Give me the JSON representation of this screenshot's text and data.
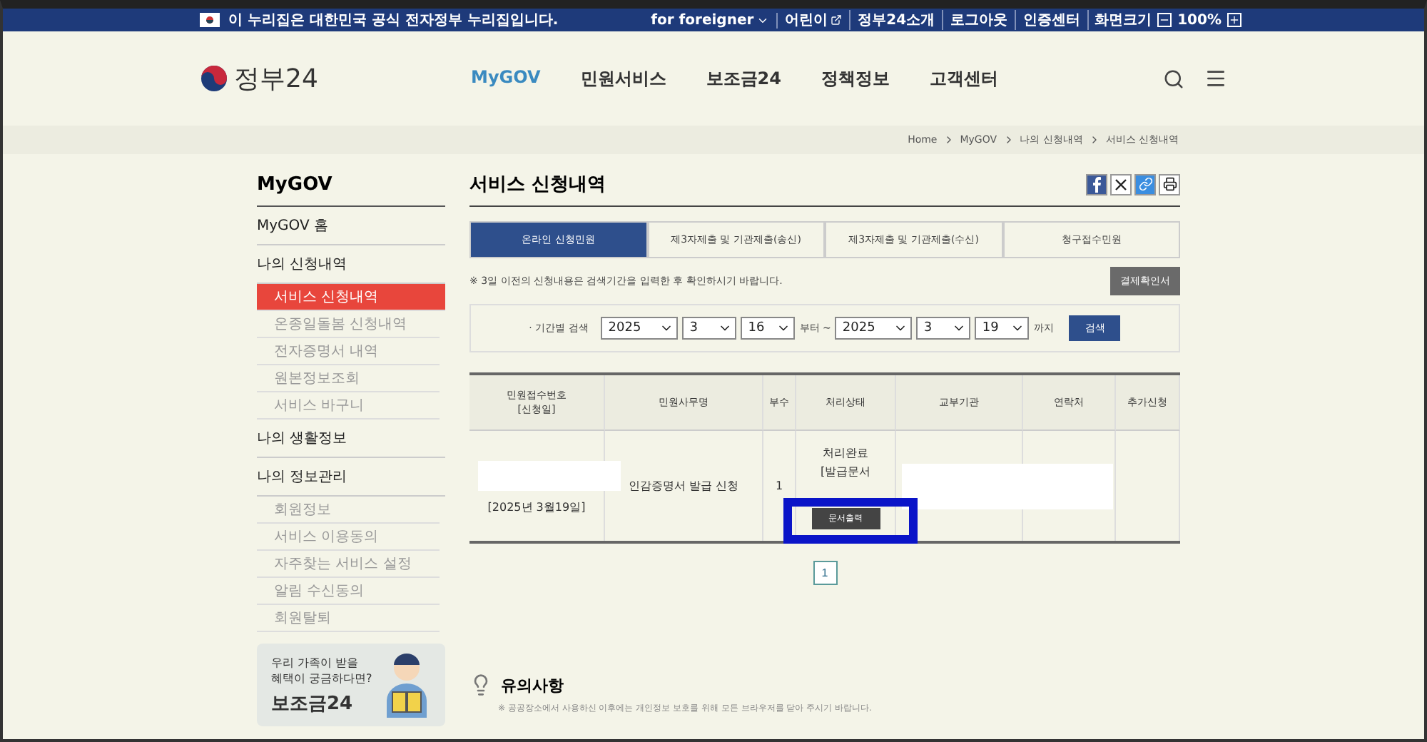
{
  "top_bar": {
    "notice": "이 누리집은 대한민국 공식 전자정부 누리집입니다.",
    "links": [
      {
        "label": "for foreigner",
        "kind": "dropdown"
      },
      {
        "label": "어린이",
        "kind": "external"
      },
      {
        "label": "정부24소개",
        "kind": "plain"
      },
      {
        "label": "로그아웃",
        "kind": "plain"
      },
      {
        "label": "인증센터",
        "kind": "plain"
      }
    ],
    "zoom_label": "화면크기",
    "zoom_value": "100%"
  },
  "header": {
    "logo_text": "정부24",
    "nav": [
      {
        "label": "MyGOV",
        "selected": true
      },
      {
        "label": "민원서비스",
        "selected": false
      },
      {
        "label": "보조금24",
        "selected": false
      },
      {
        "label": "정책정보",
        "selected": false
      },
      {
        "label": "고객센터",
        "selected": false
      }
    ]
  },
  "breadcrumb": [
    "Home",
    "MyGOV",
    "나의 신청내역",
    "서비스 신청내역"
  ],
  "sidebar": {
    "title": "MyGOV",
    "items": [
      {
        "label": "MyGOV 홈"
      },
      {
        "label": "나의 신청내역",
        "children": [
          {
            "label": "서비스 신청내역",
            "selected": true
          },
          {
            "label": "온종일돌봄 신청내역",
            "selected": false
          },
          {
            "label": "전자증명서 내역",
            "selected": false
          },
          {
            "label": "원본정보조회",
            "selected": false
          },
          {
            "label": "서비스 바구니",
            "selected": false
          }
        ]
      },
      {
        "label": "나의 생활정보"
      },
      {
        "label": "나의 정보관리",
        "children": [
          {
            "label": "회원정보",
            "selected": false
          },
          {
            "label": "서비스 이용동의",
            "selected": false
          },
          {
            "label": "자주찾는 서비스 설정",
            "selected": false
          },
          {
            "label": "알림 수신동의",
            "selected": false
          },
          {
            "label": "회원탈퇴",
            "selected": false
          }
        ]
      }
    ],
    "banner": {
      "line1": "우리 가족이 받을",
      "line2": "혜택이 궁금하다면?",
      "brand": "보조금24"
    }
  },
  "content": {
    "title": "서비스 신청내역",
    "tabs": [
      {
        "label": "온라인 신청민원",
        "selected": true
      },
      {
        "label": "제3자제출 및 기관제출(송신)",
        "selected": false
      },
      {
        "label": "제3자제출 및 기관제출(수신)",
        "selected": false
      },
      {
        "label": "청구접수민원",
        "selected": false
      }
    ],
    "notice": "※ 3일 이전의 신청내용은 검색기간을 입력한 후 확인하시기 바랍니다.",
    "receipt_button": "결제확인서",
    "search": {
      "label": "· 기간별 검색",
      "from": [
        "2025",
        "3",
        "16"
      ],
      "from_suffix": "부터 ~",
      "to": [
        "2025",
        "3",
        "19"
      ],
      "to_suffix": "까지",
      "button": "검색"
    },
    "table": {
      "columns": [
        {
          "line1": "민원접수번호",
          "line2": "[신청일]"
        },
        {
          "line1": "민원사무명"
        },
        {
          "line1": "부수"
        },
        {
          "line1": "처리상태"
        },
        {
          "line1": "교부기관"
        },
        {
          "line1": "연락처"
        },
        {
          "line1": "추가신청"
        }
      ],
      "rows": [
        {
          "date": "[2025년 3월19일]",
          "name": "인감증명서 발급 신청",
          "copies": "1",
          "status": [
            "처리완료",
            "[발급문서"
          ],
          "print_button": "문서출력"
        }
      ]
    },
    "pages": [
      {
        "label": "1",
        "selected": true
      }
    ],
    "caution": {
      "title": "유의사항",
      "text": "※ 공공장소에서 사용하신 이후에는 개인정보 보호를 위해 모든 브라우저를 닫아 주시기 바랍니다."
    }
  }
}
